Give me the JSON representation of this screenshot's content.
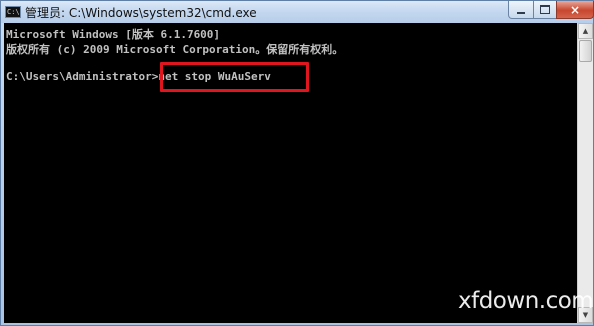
{
  "window": {
    "title": "管理员: C:\\Windows\\system32\\cmd.exe",
    "icon_text": "C:\\",
    "controls": {
      "minimize": "minimize-icon",
      "maximize": "maximize-icon",
      "close": "×"
    }
  },
  "console": {
    "lines": [
      "Microsoft Windows [版本 6.1.7600]",
      "版权所有 (c) 2009 Microsoft Corporation。保留所有权利。",
      "C:\\Users\\Administrator>net stop WuAuServ"
    ],
    "highlighted_command": "net stop WuAuServ",
    "colors": {
      "background": "#000000",
      "text": "#c0c0c0",
      "highlight_border": "#e0161f"
    }
  },
  "scrollbar": {
    "up_glyph": "▲",
    "down_glyph": "▼"
  },
  "watermark": "xfdown.com"
}
